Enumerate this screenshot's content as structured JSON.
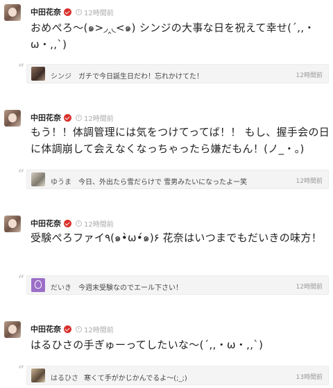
{
  "posts": [
    {
      "author": "中田花奈",
      "time": "12時間前",
      "text": "おめぺろ〜(๑>◞‸◟<๑) シンジの大事な日を祝えて幸せ(´,,・ω・,,`)",
      "reply": {
        "name": "シンジ",
        "text": "ガチで今日誕生日だわ！忘れかけてた！",
        "time": "12時間前"
      }
    },
    {
      "author": "中田花奈",
      "time": "12時間前",
      "text": "もう！！体調管理には気をつけてってば！！ もし、握手会の日に体調崩して会えなくなっちゃったら嫌だもん！(ノ_・。)",
      "reply": {
        "name": "ゆうま",
        "text": "今日、外出たら雪だらけで 雪男みたいになったよー笑",
        "time": "12時間前"
      }
    },
    {
      "author": "中田花奈",
      "time": "12時間前",
      "text": "受験ぺろファイ٩(๑•̀ω•́๑)۶ 花奈はいつまでもだいきの味方！",
      "reply": {
        "name": "だいき",
        "text": "今週末受験なのでエール下さい！",
        "time": "12時間前"
      }
    },
    {
      "author": "中田花奈",
      "time": "12時間前",
      "text": "はるひさの手ぎゅーってしたいな〜(´,,・ω・,,`)",
      "reply": {
        "name": "はるひさ",
        "text": "寒くて手がかじかんでるよ〜(;_;)",
        "time": "13時間前"
      }
    }
  ]
}
